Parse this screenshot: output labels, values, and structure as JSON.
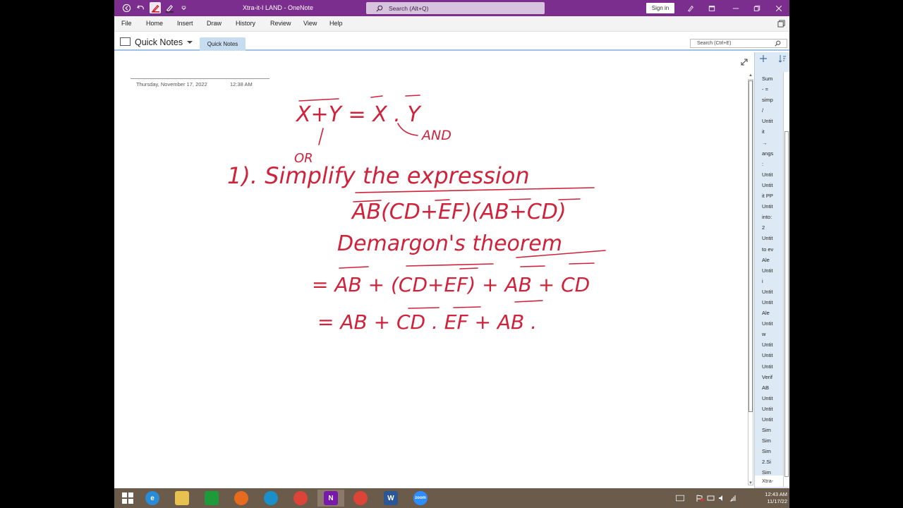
{
  "titlebar": {
    "doc_title": "Xtra-it-I  LAND  -  OneNote",
    "search_placeholder": "Search (Alt+Q)",
    "signin_label": "Sign in"
  },
  "menu": [
    "File",
    "Home",
    "Insert",
    "Draw",
    "History",
    "Review",
    "View",
    "Help"
  ],
  "notebook": {
    "name": "Quick Notes",
    "section_tab": "Quick Notes",
    "search_placeholder": "Search (Ctrl+E)"
  },
  "page": {
    "date": "Thursday, November 17, 2022",
    "time": "12:38 AM"
  },
  "pagelist": {
    "items": [
      "Sum",
      "-  =",
      "simp",
      "/",
      "Untit",
      "it",
      "→",
      "angs",
      ":",
      "Untit",
      "Untit",
      "it PP",
      "Untit",
      "into:",
      "2",
      "Untit",
      "to ev",
      "Ale",
      "Untit",
      "i",
      "Untit",
      "Untit",
      "Ale",
      "Untit",
      "w",
      "Untit",
      "Untit",
      "Untit",
      "Verif",
      "AB",
      "Untit",
      "Untit",
      "Untit",
      "Sim",
      "Sim",
      "Sim",
      "2.Si",
      "Sim"
    ],
    "footer": "Xtra-"
  },
  "ink": {
    "line1": "X+Y = X . Y",
    "or_label": "OR",
    "and_label": "AND",
    "line2": "1). Simplify the expression",
    "line3": "AB(CD+EF)(AB+CD)",
    "line4": "Demargon's theorem",
    "line5": "= AB + (CD+EF) + AB + CD",
    "line6": "= AB + CD . EF + AB ."
  },
  "taskbar": {
    "time": "12:43 AM",
    "date": "11/17/22"
  },
  "colors": {
    "titlebar": "#7b2e8e",
    "ink": "#d0223a",
    "section_tab": "#c8dcf0",
    "pagelist_bg": "#ddeaf6"
  }
}
